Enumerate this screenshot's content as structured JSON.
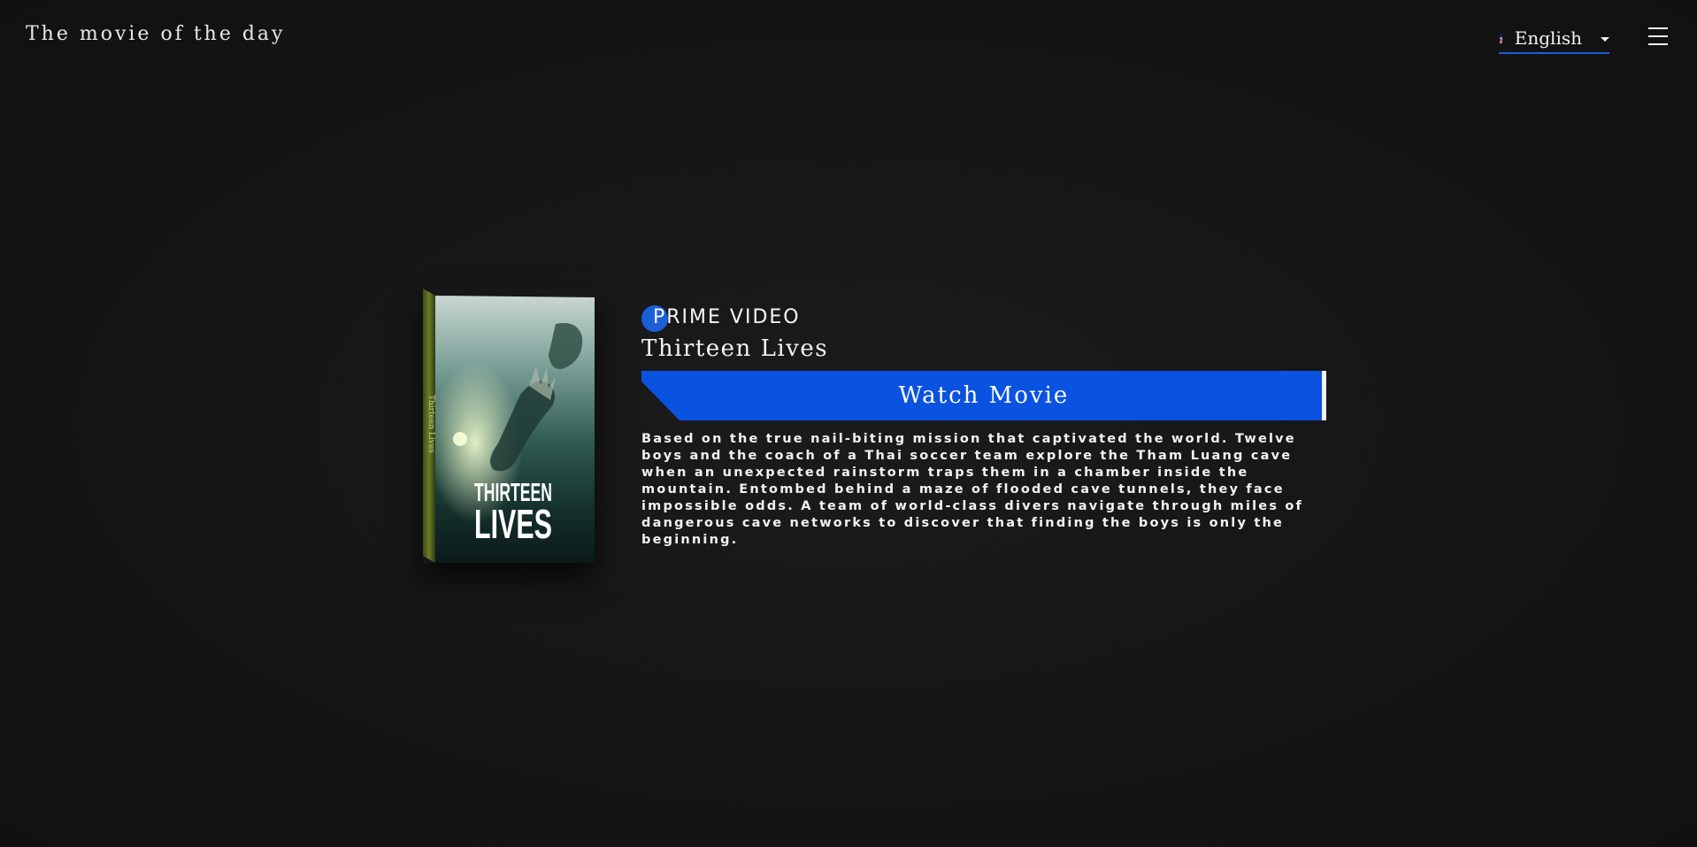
{
  "header": {
    "site_title": "The movie of the day",
    "language": {
      "flag_icon": "uk-flag-icon",
      "selected": "English"
    },
    "menu_icon": "hamburger-menu-icon"
  },
  "movie": {
    "provider": "PRIME VIDEO",
    "title": "Thirteen Lives",
    "poster_text_line1": "THIRTEEN",
    "poster_text_line2": "LIVES",
    "poster_spine_text": "Thirteen Lives",
    "watch_button_label": "Watch Movie",
    "synopsis": "Based on the true nail-biting mission that captivated the world. Twelve boys and the coach of a Thai soccer team explore the Tham Luang cave when an unexpected rainstorm traps them in a chamber inside the mountain. Entombed behind a maze of flooded cave tunnels, they face impossible odds. A team of world-class divers navigate through miles of dangerous cave networks to discover that finding the boys is only the beginning."
  },
  "colors": {
    "accent": "#0a52e0",
    "background": "#161616",
    "text": "#f2f2f2"
  }
}
